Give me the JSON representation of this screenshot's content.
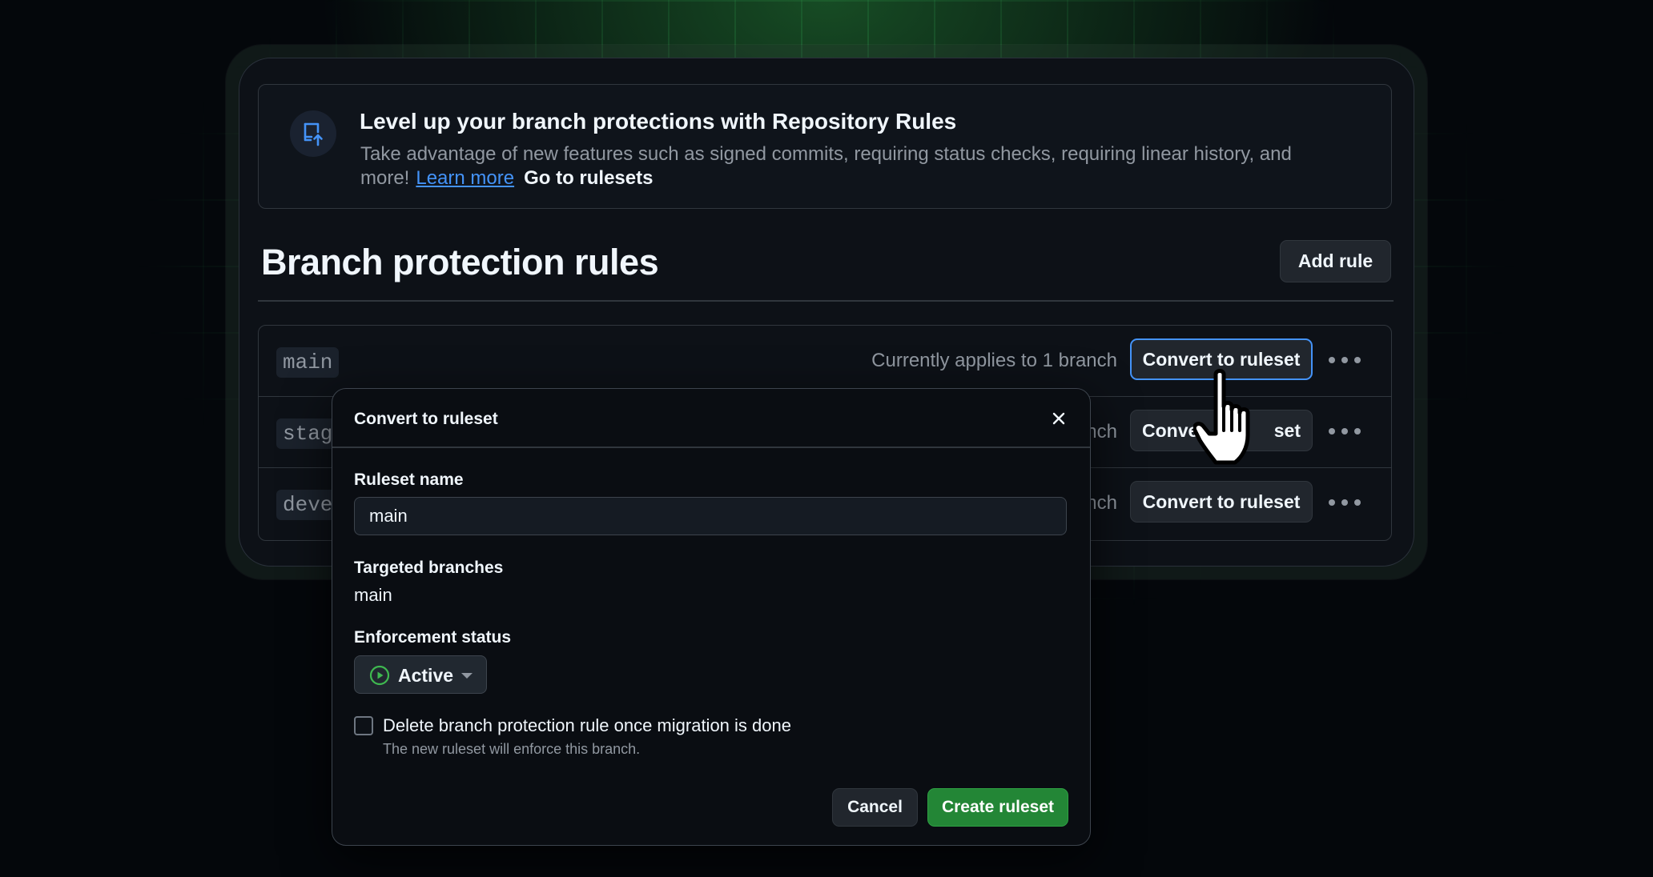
{
  "banner": {
    "title": "Level up your branch protections with Repository Rules",
    "description": "Take advantage of new features such as signed commits, requiring status checks, requiring linear history, and more!",
    "learn_more": "Learn more",
    "go_to_rulesets": "Go to rulesets",
    "icon": "repo-push-icon"
  },
  "page": {
    "title": "Branch protection rules",
    "add_rule": "Add rule"
  },
  "rules": [
    {
      "branch": "main",
      "applies": "Currently applies to 1 branch",
      "convert": "Convert to ruleset"
    },
    {
      "branch": "stag",
      "applies": "nch",
      "convert": "Conve",
      "convert_tail": "set"
    },
    {
      "branch": "deve",
      "applies": "nch",
      "convert": "Convert to ruleset"
    }
  ],
  "dialog": {
    "title": "Convert to ruleset",
    "ruleset_name_label": "Ruleset name",
    "ruleset_name_value": "main",
    "targeted_label": "Targeted branches",
    "targeted_value": "main",
    "enforcement_label": "Enforcement status",
    "enforcement_value": "Active",
    "delete_checkbox_label": "Delete branch protection rule once migration is done",
    "delete_checkbox_help": "The new ruleset will enforce this branch.",
    "delete_checked": false,
    "cancel": "Cancel",
    "create": "Create ruleset"
  },
  "colors": {
    "accent_blue": "#4493f8",
    "success_green": "#238636",
    "active_status": "#3fb950"
  }
}
